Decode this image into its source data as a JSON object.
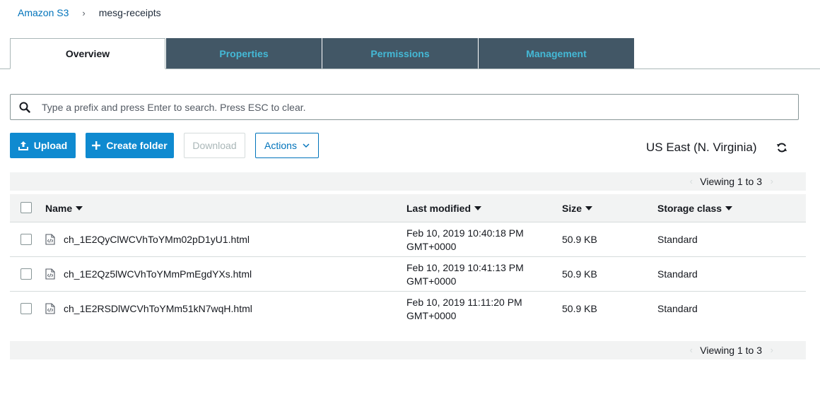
{
  "breadcrumb": {
    "root": "Amazon S3",
    "separator": "›",
    "current": "mesg-receipts"
  },
  "tabs": [
    {
      "label": "Overview",
      "active": true
    },
    {
      "label": "Properties",
      "active": false
    },
    {
      "label": "Permissions",
      "active": false
    },
    {
      "label": "Management",
      "active": false
    }
  ],
  "search": {
    "placeholder": "Type a prefix and press Enter to search. Press ESC to clear.",
    "value": ""
  },
  "toolbar": {
    "upload_label": "Upload",
    "create_folder_label": "Create folder",
    "download_label": "Download",
    "actions_label": "Actions",
    "region": "US East (N. Virginia)"
  },
  "pagination": {
    "top_label": "Viewing 1 to 3",
    "bottom_label": "Viewing 1 to 3"
  },
  "table": {
    "columns": {
      "name": "Name",
      "last_modified": "Last modified",
      "size": "Size",
      "storage_class": "Storage class"
    },
    "rows": [
      {
        "name": "ch_1E2QyClWCVhToYMm02pD1yU1.html",
        "modified_line1": "Feb 10, 2019 10:40:18 PM",
        "modified_line2": "GMT+0000",
        "size": "50.9 KB",
        "storage_class": "Standard"
      },
      {
        "name": "ch_1E2Qz5lWCVhToYMmPmEgdYXs.html",
        "modified_line1": "Feb 10, 2019 10:41:13 PM",
        "modified_line2": "GMT+0000",
        "size": "50.9 KB",
        "storage_class": "Standard"
      },
      {
        "name": "ch_1E2RSDlWCVhToYMm51kN7wqH.html",
        "modified_line1": "Feb 10, 2019 11:11:20 PM",
        "modified_line2": "GMT+0000",
        "size": "50.9 KB",
        "storage_class": "Standard"
      }
    ]
  },
  "colors": {
    "primary": "#0f8ad0",
    "tab_bg": "#425766",
    "tab_text": "#44b9d6",
    "link": "#0073bb"
  },
  "icons": [
    "search-icon",
    "upload-icon",
    "plus-icon",
    "chevron-down-icon",
    "refresh-icon",
    "file-code-icon"
  ]
}
